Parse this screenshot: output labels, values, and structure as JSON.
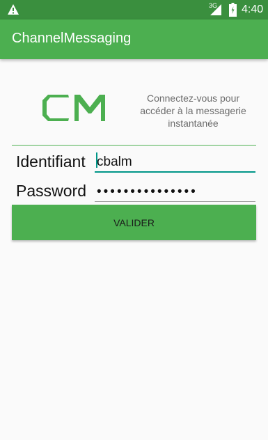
{
  "status_bar": {
    "network": "3G",
    "time": "4:40"
  },
  "app_bar": {
    "title": "ChannelMessaging"
  },
  "logo": {
    "text": "CM",
    "color": "#4caf50"
  },
  "tagline": "Connectez-vous pour accéder à la messagerie instantanée",
  "form": {
    "login_label": "Identifiant",
    "login_value": "cbalm",
    "password_label": "Password",
    "password_value": "•••••••••••••••"
  },
  "submit_label": "VALIDER",
  "colors": {
    "status_bar": "#3a8f3e",
    "app_bar": "#4caf50",
    "accent": "#009688",
    "background": "#fafafa"
  }
}
